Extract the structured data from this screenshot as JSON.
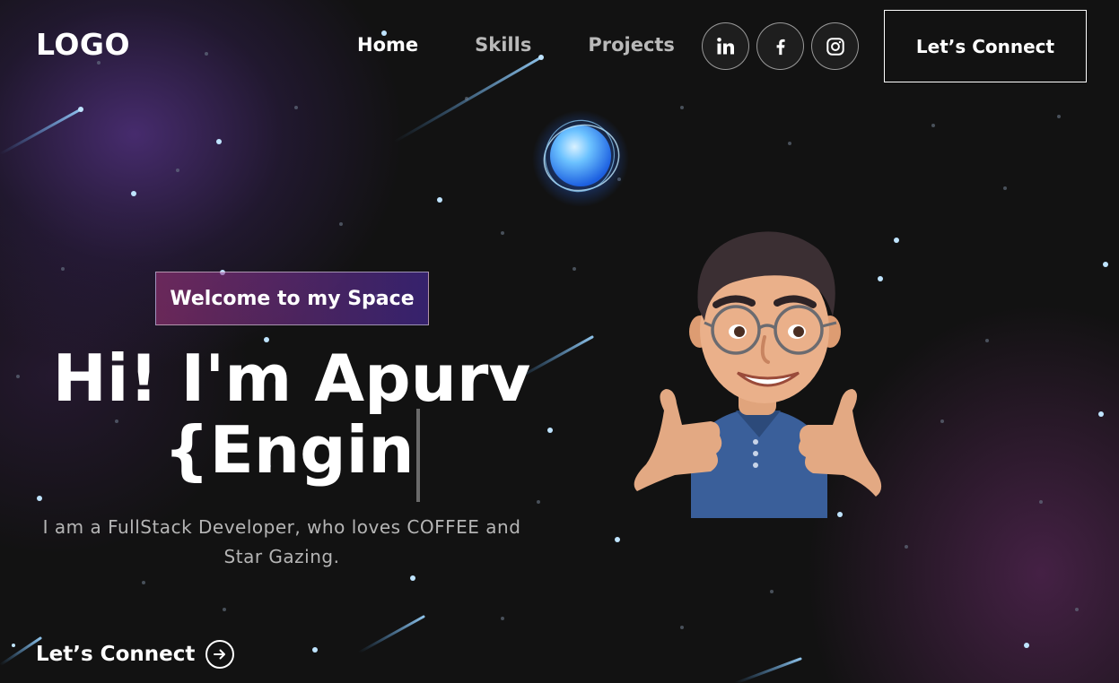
{
  "nav": {
    "logo": "LOGO",
    "links": [
      {
        "label": "Home",
        "active": true
      },
      {
        "label": "Skills",
        "active": false
      },
      {
        "label": "Projects",
        "active": false
      }
    ],
    "social": [
      {
        "icon": "linkedin-icon"
      },
      {
        "icon": "facebook-icon"
      },
      {
        "icon": "instagram-icon"
      }
    ],
    "cta_label": "Let’s Connect"
  },
  "hero": {
    "tagline": "Welcome to my Space",
    "headline_line1": "Hi! I'm Apurv",
    "headline_line2": "{Engin",
    "intro": "I am a FullStack Developer, who loves COFFEE and Star Gazing.",
    "cta_label": "Let’s Connect",
    "cta_icon": "arrow-right-circle-icon"
  },
  "colors": {
    "background": "#121212",
    "tagline_gradient_start": "#aa367c",
    "tagline_gradient_end": "#4a2fbd",
    "nav_inactive": "#b9b9b9",
    "planet_glow": "#3fa0ff"
  }
}
